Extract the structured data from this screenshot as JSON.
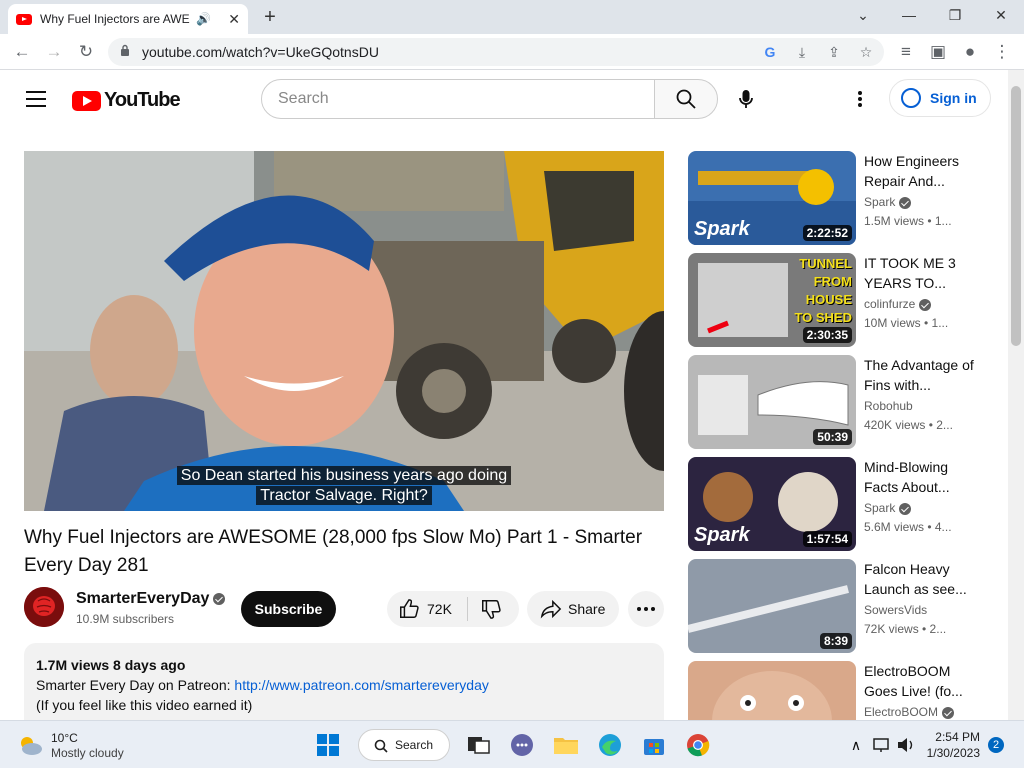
{
  "browser": {
    "tab_title": "Why Fuel Injectors are AWESOME",
    "url": "youtube.com/watch?v=UkeGQotnsDU",
    "new_tab": "+",
    "tab_close": "✕",
    "audio_icon": "🔊"
  },
  "youtube": {
    "logo_text": "YouTube",
    "search_placeholder": "Search",
    "signin_label": "Sign in"
  },
  "video": {
    "caption_line1": "So Dean started his business years ago doing",
    "caption_line2": "Tractor Salvage. Right?",
    "title": "Why Fuel Injectors are AWESOME (28,000 fps Slow Mo) Part 1 - Smarter Every Day 281",
    "channel": "SmarterEveryDay",
    "subscribers": "10.9M subscribers",
    "subscribe_label": "Subscribe",
    "likes": "72K",
    "share_label": "Share",
    "views_meta": "1.7M views  8 days ago",
    "desc_line1_text": "Smarter Every Day on Patreon: ",
    "desc_line1_link": "http://www.patreon.com/smartereveryday",
    "desc_line2": "(If you feel like this video earned it)"
  },
  "related": [
    {
      "title": "How Engineers Repair And...",
      "channel": "Spark",
      "meta": "1.5M views  • 1...",
      "duration": "2:22:52",
      "verified": true,
      "overlay": "Spark",
      "color": "#3b6fb0"
    },
    {
      "title": "IT TOOK ME 3 YEARS TO...",
      "channel": "colinfurze",
      "meta": "10M views  • 1...",
      "duration": "2:30:35",
      "verified": true,
      "overlay": "",
      "color": "#7a7a7a"
    },
    {
      "title": "The Advantage of Fins with...",
      "channel": "Robohub",
      "meta": "420K views  • 2...",
      "duration": "50:39",
      "verified": false,
      "overlay": "",
      "color": "#b8b8b8"
    },
    {
      "title": "Mind-Blowing Facts About...",
      "channel": "Spark",
      "meta": "5.6M views  • 4...",
      "duration": "1:57:54",
      "verified": true,
      "overlay": "Spark",
      "color": "#2c2440"
    },
    {
      "title": "Falcon Heavy Launch as see...",
      "channel": "SowersVids",
      "meta": "72K views  • 2...",
      "duration": "8:39",
      "verified": false,
      "overlay": "",
      "color": "#8f9aa8"
    },
    {
      "title": "ElectroBOOM Goes Live! (fo...",
      "channel": "ElectroBOOM",
      "meta": "",
      "duration": "",
      "verified": true,
      "overlay": "",
      "color": "#d9a88a"
    }
  ],
  "thumb_text": {
    "tunnel_1": "TUNNEL",
    "tunnel_2": "FROM",
    "tunnel_3": "HOUSE",
    "tunnel_4": "TO SHED"
  },
  "taskbar": {
    "temp": "10°C",
    "weather": "Mostly cloudy",
    "search_label": "Search",
    "time": "2:54 PM",
    "date": "1/30/2023",
    "notifications": "2"
  }
}
